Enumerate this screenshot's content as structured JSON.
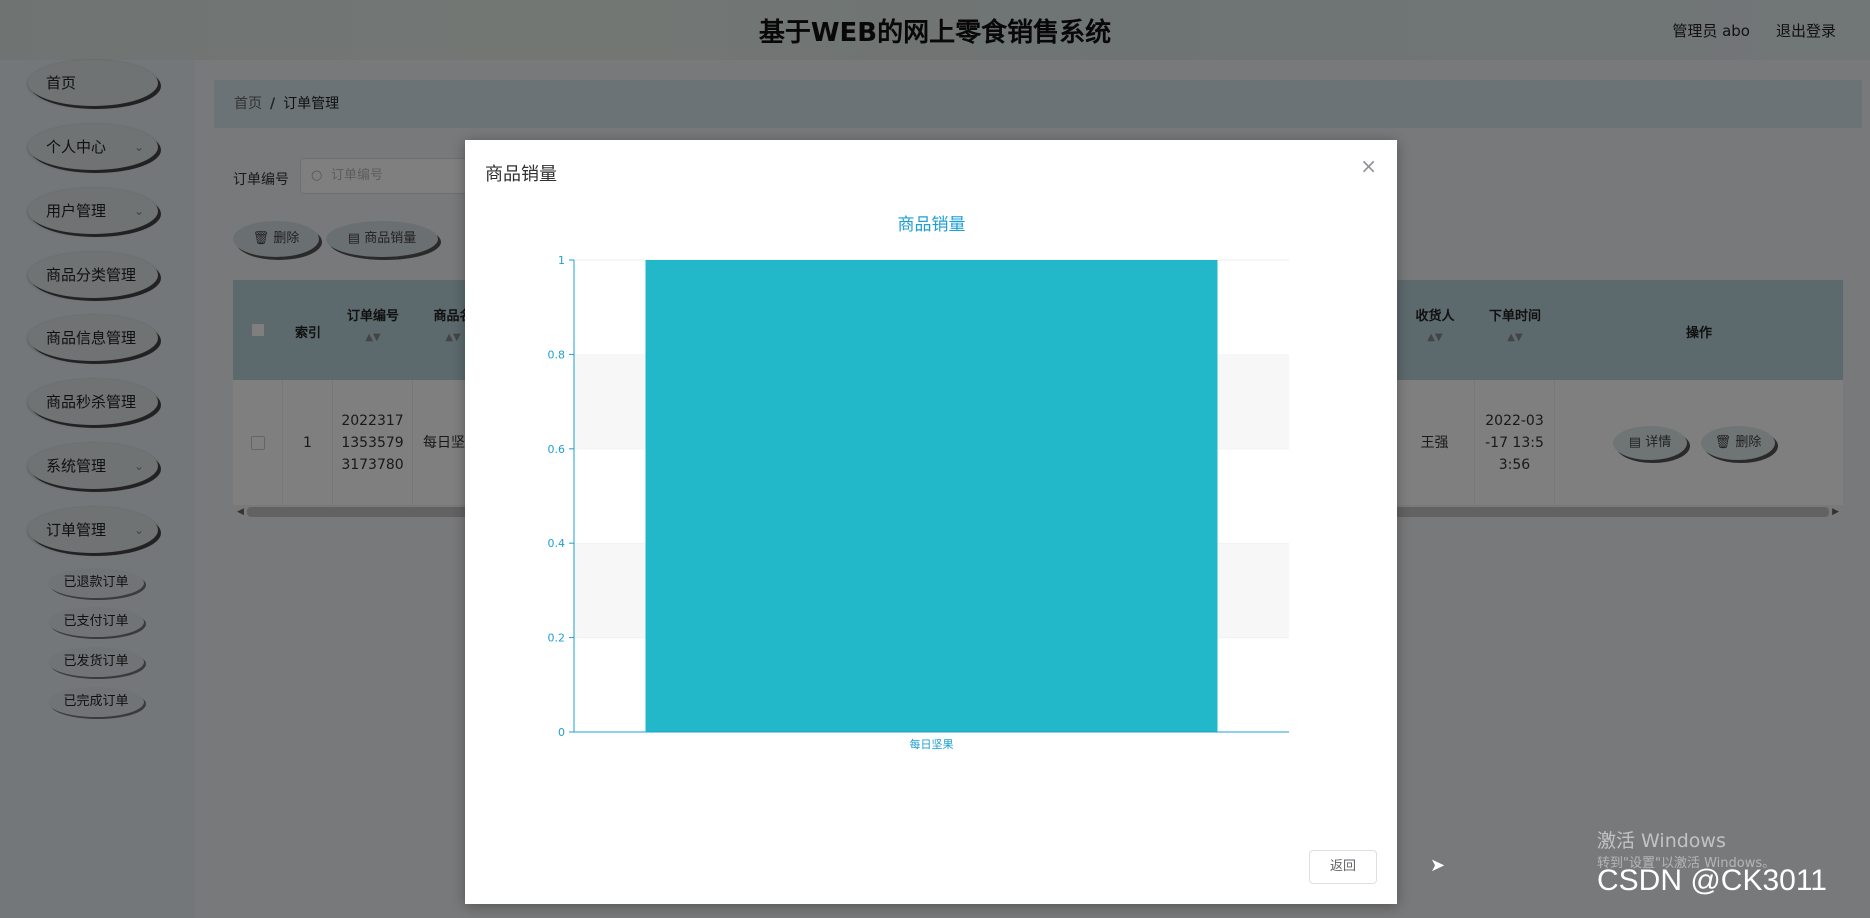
{
  "header": {
    "title": "基于WEB的网上零食销售系统",
    "user": "管理员 abo",
    "logout": "退出登录"
  },
  "sidebar": {
    "items": [
      {
        "label": "首页",
        "chevron": false
      },
      {
        "label": "个人中心",
        "chevron": true
      },
      {
        "label": "用户管理",
        "chevron": true
      },
      {
        "label": "商品分类管理",
        "chevron": false
      },
      {
        "label": "商品信息管理",
        "chevron": false
      },
      {
        "label": "商品秒杀管理",
        "chevron": false
      },
      {
        "label": "系统管理",
        "chevron": true
      },
      {
        "label": "订单管理",
        "chevron": true
      }
    ],
    "sub_items": [
      "已退款订单",
      "已支付订单",
      "已发货订单",
      "已完成订单"
    ]
  },
  "breadcrumb": {
    "home": "首页",
    "separator": "/",
    "current": "订单管理"
  },
  "search": {
    "label": "订单编号",
    "placeholder": "订单编号"
  },
  "actions": {
    "delete": "删除",
    "sales": "商品销量"
  },
  "table": {
    "headers": [
      "索引",
      "订单编号",
      "商品名",
      "收货人",
      "下单时间",
      "操作"
    ],
    "row": {
      "index": "1",
      "order_no": [
        "2022317",
        "1353579",
        "3173780"
      ],
      "product": "每日坚",
      "receiver": "王强",
      "time": [
        "2022-03",
        "-17 13:5",
        "3:56"
      ],
      "detail": "详情",
      "delete": "删除"
    }
  },
  "dialog": {
    "title": "商品销量",
    "close": "×",
    "back": "返回"
  },
  "chart_data": {
    "type": "bar",
    "title": "商品销量",
    "categories": [
      "每日坚果"
    ],
    "values": [
      1
    ],
    "ylim": [
      0,
      1
    ],
    "yticks": [
      "0",
      "0.2",
      "0.4",
      "0.6",
      "0.8",
      "1"
    ],
    "color": "#22b8ca",
    "axis_color": "#1e9fd3"
  },
  "watermark": {
    "line1": "激活 Windows",
    "line2": "转到\"设置\"以激活 Windows。",
    "csdn": "CSDN @CK3011"
  }
}
